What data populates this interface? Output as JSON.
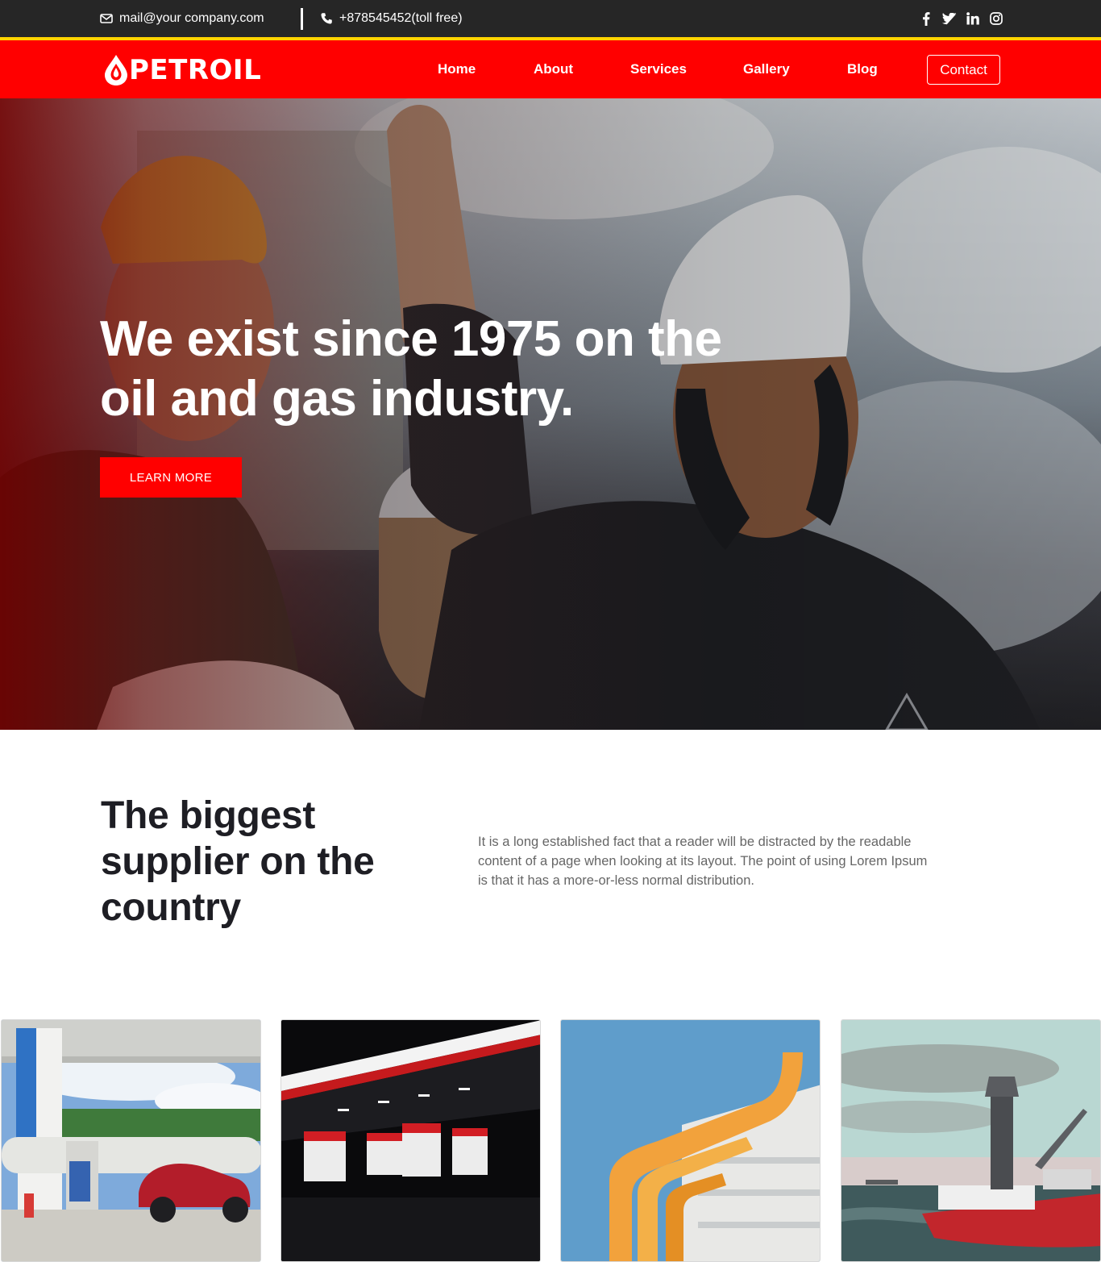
{
  "topbar": {
    "email": "mail@your company.com",
    "phone": "+878545452(toll free)",
    "socials": [
      "facebook-icon",
      "twitter-icon",
      "linkedin-icon",
      "instagram-icon"
    ]
  },
  "header": {
    "logo_text": "PETROIL",
    "nav": [
      "Home",
      "About",
      "Services",
      "Gallery",
      "Blog"
    ],
    "contact_label": "Contact"
  },
  "hero": {
    "title": "We exist since 1975 on the oil and gas industry.",
    "button_label": "LEARN MORE"
  },
  "intro": {
    "heading": "The biggest supplier on the country",
    "text": "It is a long established fact that a reader will be distracted by the readable content of a page when looking at its layout. The point of using Lorem Ipsum is that it has a more-or-less normal distribution."
  },
  "gallery": [
    {
      "image": "gas-station-daytime"
    },
    {
      "image": "gas-station-night"
    },
    {
      "image": "orange-pipes"
    },
    {
      "image": "offshore-drillship"
    }
  ],
  "colors": {
    "brand_red": "#ff0000",
    "accent_yellow": "#ffd300",
    "topbar_dark": "#262626"
  }
}
